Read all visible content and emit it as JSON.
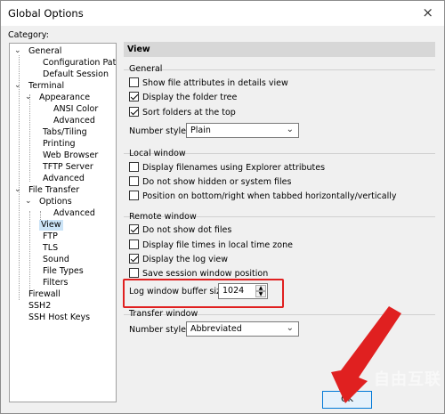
{
  "window": {
    "title": "Global Options",
    "close_icon": "×"
  },
  "category_label": "Category:",
  "tree": [
    {
      "label": "General",
      "toggle": "⌄"
    },
    {
      "label": "Configuration Paths"
    },
    {
      "label": "Default Session"
    },
    {
      "label": "Terminal",
      "toggle": "⌄"
    },
    {
      "label": "Appearance",
      "toggle": "⌄"
    },
    {
      "label": "ANSI Color"
    },
    {
      "label": "Advanced"
    },
    {
      "label": "Tabs/Tiling"
    },
    {
      "label": "Printing"
    },
    {
      "label": "Web Browser"
    },
    {
      "label": "TFTP Server"
    },
    {
      "label": "Advanced"
    },
    {
      "label": "File Transfer",
      "toggle": "⌄"
    },
    {
      "label": "Options",
      "toggle": "⌄"
    },
    {
      "label": "Advanced"
    },
    {
      "label": "View"
    },
    {
      "label": "FTP"
    },
    {
      "label": "TLS"
    },
    {
      "label": "Sound"
    },
    {
      "label": "File Types"
    },
    {
      "label": "Filters"
    },
    {
      "label": "Firewall"
    },
    {
      "label": "SSH2"
    },
    {
      "label": "SSH Host Keys"
    }
  ],
  "selected_item": "View",
  "panel": {
    "header": "View",
    "general": {
      "label": "General",
      "show_attributes": {
        "label": "Show file attributes in details view",
        "checked": false
      },
      "display_tree": {
        "label": "Display the folder tree",
        "checked": true
      },
      "sort_folders": {
        "label": "Sort folders at the top",
        "checked": true
      },
      "number_style_label": "Number style:",
      "number_style_value": "Plain"
    },
    "local": {
      "label": "Local window",
      "explorer_attrs": {
        "label": "Display filenames using Explorer attributes",
        "checked": false
      },
      "hidden_files": {
        "label": "Do not show hidden or system files",
        "checked": false
      },
      "position_bottom": {
        "label": "Position on bottom/right when tabbed horizontally/vertically",
        "checked": false
      }
    },
    "remote": {
      "label": "Remote window",
      "dot_files": {
        "label": "Do not show dot files",
        "checked": true
      },
      "local_time": {
        "label": "Display file times in local time zone",
        "checked": false
      },
      "log_view": {
        "label": "Display the log view",
        "checked": true
      },
      "save_position": {
        "label": "Save session window position",
        "checked": false
      },
      "buffer_label": "Log window buffer size:",
      "buffer_value": "1024"
    },
    "transfer": {
      "label": "Transfer window",
      "number_style_label": "Number style:",
      "number_style_value": "Abbreviated"
    }
  },
  "ok_button": "OK",
  "watermark": "自由互联",
  "annotation_color": "#e02020"
}
